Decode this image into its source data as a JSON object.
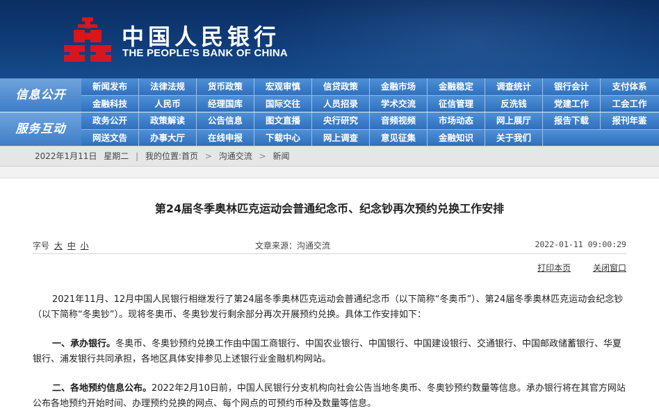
{
  "header": {
    "title_cn": "中国人民银行",
    "title_en": "THE PEOPLE'S BANK OF CHINA",
    "brand_color": "#0f3c78",
    "logo_color": "#d8161b"
  },
  "nav": {
    "group1_title": "信息公开",
    "group1_row1": [
      "新闻发布",
      "法律法规",
      "货币政策",
      "宏观审慎",
      "信贷政策",
      "金融市场",
      "金融稳定",
      "调查统计",
      "银行会计",
      "支付体系"
    ],
    "group1_row2": [
      "金融科技",
      "人民币",
      "经理国库",
      "国际交往",
      "人员招录",
      "学术交流",
      "征信管理",
      "反洗钱",
      "党建工作",
      "工会工作"
    ],
    "group2_title": "服务互动",
    "group2_row1": [
      "政务公开",
      "政策解读",
      "公告信息",
      "图文直播",
      "央行研究",
      "音频视频",
      "市场动态",
      "网上展厅",
      "报告下载",
      "报刊年鉴"
    ],
    "group2_row2": [
      "网送文告",
      "办事大厅",
      "在线申报",
      "下载中心",
      "网上调查",
      "意见征集",
      "金融知识",
      "关于我们"
    ]
  },
  "breadcrumb": {
    "date": "2022年1月11日",
    "weekday": "星期二",
    "location_label": "我的位置:",
    "home": "首页",
    "section": "沟通交流",
    "page": "新闻"
  },
  "article": {
    "title": "第24届冬季奥林匹克运动会普通纪念币、纪念钞再次预约兑换工作安排",
    "font_label": "字号",
    "font_large": "大",
    "font_medium": "中",
    "font_small": "小",
    "source": "文章来源：沟通交流",
    "datetime": "2022-01-11 09:00:29",
    "print_label": "打印本页",
    "close_label": "关闭窗口",
    "p1": "2021年11月、12月中国人民银行相继发行了第24届冬季奥林匹克运动会普通纪念币（以下简称“冬奥币”）、第24届冬季奥林匹克运动会纪念钞（以下简称“冬奥钞”）。现将冬奥币、冬奥钞发行剩余部分再次开展预约兑换。具体工作安排如下：",
    "p2_head": "一、承办银行。",
    "p2_body": "冬奥币、冬奥钞预约兑换工作由中国工商银行、中国农业银行、中国银行、中国建设银行、交通银行、中国邮政储蓄银行、华夏银行、浦发银行共同承担，各地区具体安排参见上述银行业金融机构网站。",
    "p3_head": "二、各地预约信息公布。",
    "p3_body": "2022年2月10日前，中国人民银行分支机构向社会公告当地冬奥币、冬奥钞预约数量等信息。承办银行将在其官方网站公布各地预约开始时间、办理预约兑换的网点、每个网点的可预约币种及数量等信息。"
  }
}
